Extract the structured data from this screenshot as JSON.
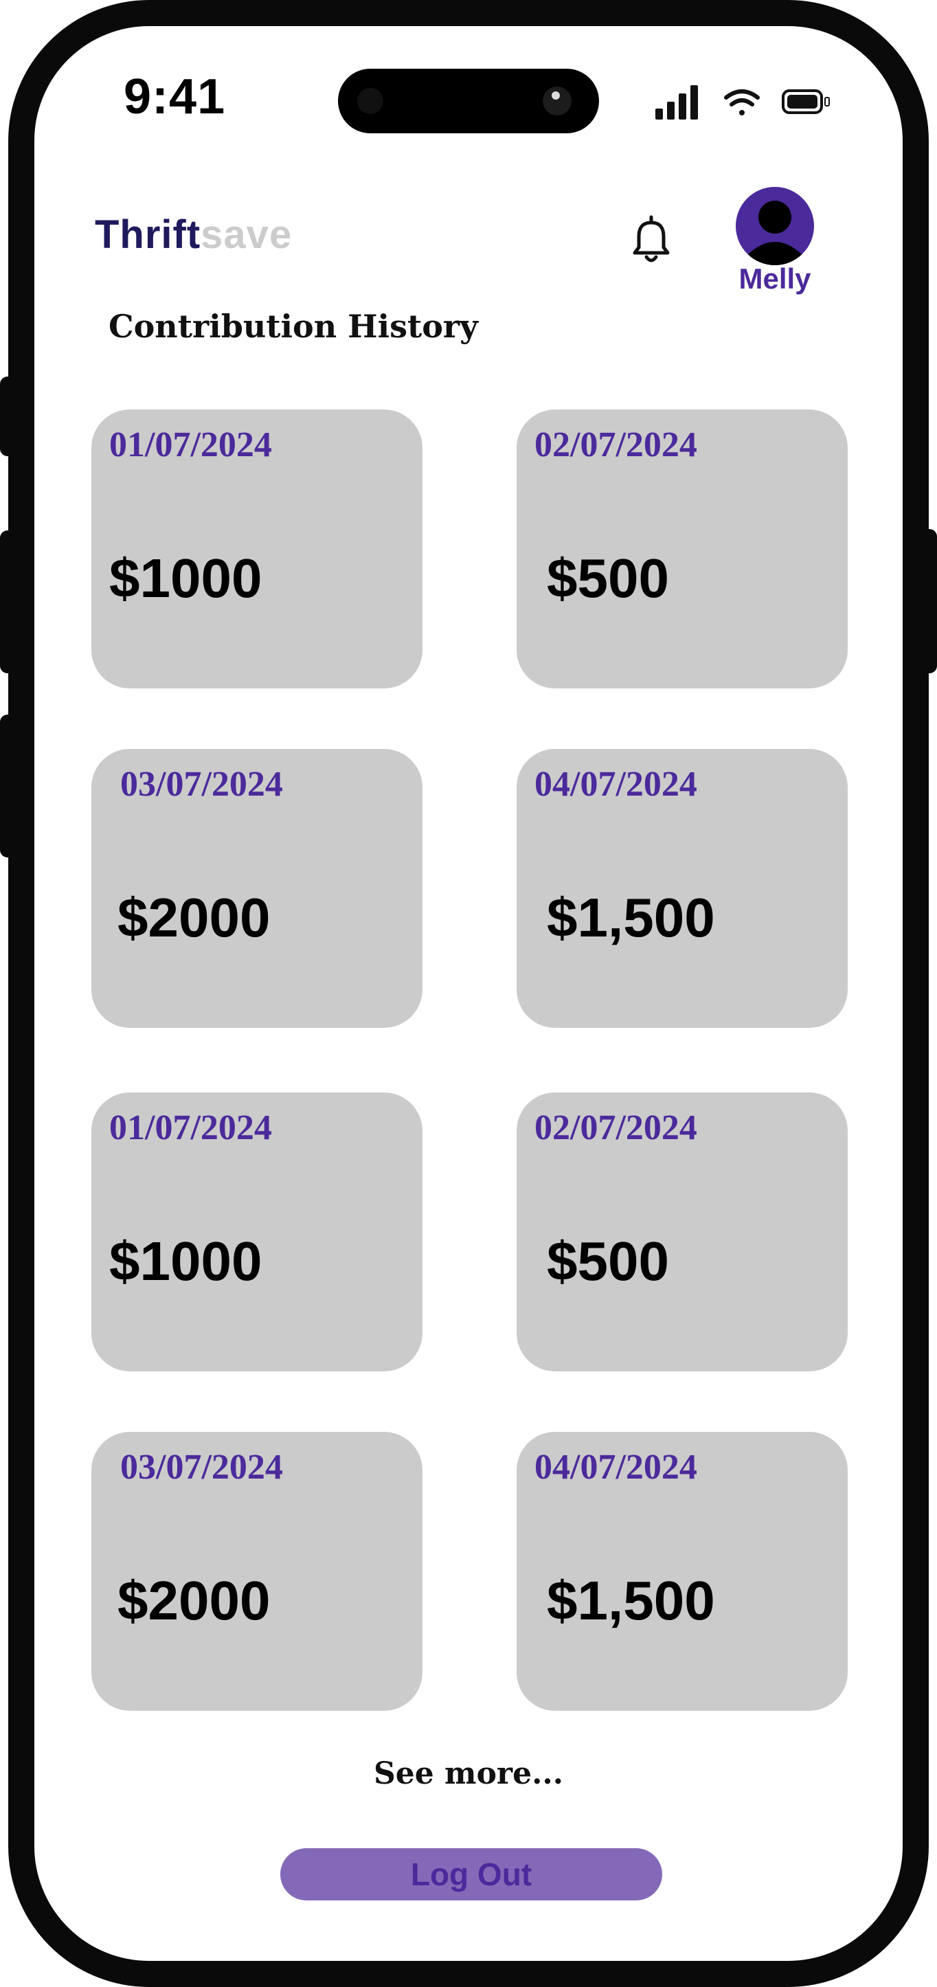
{
  "status_bar": {
    "time": "9:41",
    "icons": [
      "signal-icon",
      "wifi-icon",
      "battery-icon"
    ]
  },
  "header": {
    "brand_part1": "Thrift",
    "brand_part2": "save",
    "notification_icon": "bell-icon",
    "avatar_icon": "user-avatar-icon",
    "username": "Melly"
  },
  "page_title": "Contribution History",
  "contributions": [
    {
      "date": "01/07/2024",
      "amount": "$1000"
    },
    {
      "date": "02/07/2024",
      "amount": "$500"
    },
    {
      "date": "03/07/2024",
      "amount": "$2000"
    },
    {
      "date": "04/07/2024",
      "amount": "$1,500"
    },
    {
      "date": "01/07/2024",
      "amount": "$1000"
    },
    {
      "date": "02/07/2024",
      "amount": "$500"
    },
    {
      "date": "03/07/2024",
      "amount": "$2000"
    },
    {
      "date": "04/07/2024",
      "amount": "$1,500"
    }
  ],
  "see_more_label": "See more...",
  "logout_label": "Log Out",
  "colors": {
    "brand_dark": "#1f1a5c",
    "brand_light": "#cccccc",
    "accent": "#4b2a9b",
    "card_bg": "#cbcbcb",
    "logout_bg": "#8469b8"
  }
}
